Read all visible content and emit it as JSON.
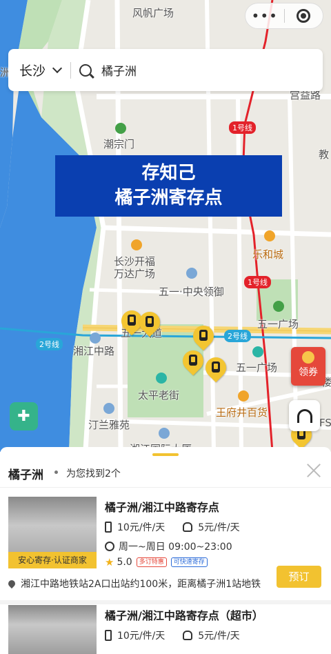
{
  "top": {
    "more_label": "•••"
  },
  "search": {
    "city": "长沙",
    "query": "橘子洲"
  },
  "banner": {
    "line1": "存知己",
    "line2": "橘子洲寄存点"
  },
  "map": {
    "labels": [
      {
        "text": "风帆广场",
        "style": "plain"
      },
      {
        "text": "宫益路",
        "style": "plain"
      },
      {
        "text": "潮宗门",
        "style": "plain"
      },
      {
        "text": "教",
        "style": "plain"
      },
      {
        "text": "乐和城",
        "style": "orange"
      },
      {
        "text": "长沙开福",
        "style": "plain"
      },
      {
        "text": "万达广场",
        "style": "plain"
      },
      {
        "text": "五一·中央领御",
        "style": "plain"
      },
      {
        "text": "五一广场",
        "style": "plain"
      },
      {
        "text": "五一大道",
        "style": "plain"
      },
      {
        "text": "湘江中路",
        "style": "plain"
      },
      {
        "text": "五一广场",
        "style": "plain"
      },
      {
        "text": "太平老街",
        "style": "plain"
      },
      {
        "text": "王府井百货",
        "style": "orange"
      },
      {
        "text": "汀兰雅苑",
        "style": "plain"
      },
      {
        "text": "湘江国际大厦",
        "style": "plain"
      },
      {
        "text": "洲",
        "style": "plain"
      },
      {
        "text": "FS",
        "style": "plain"
      },
      {
        "text": "楼",
        "style": "plain"
      }
    ],
    "line_badges": [
      "1号线",
      "1号线",
      "2号线",
      "2号线"
    ],
    "coupon_label": "领券"
  },
  "sheet": {
    "title": "橘子洲",
    "count_text": "为您找到2个"
  },
  "results": [
    {
      "name": "橘子洲/湘江中路寄存点",
      "tag": "安心寄存·认证商家",
      "price_luggage": "10元/件/天",
      "price_bag": "5元/件/天",
      "hours": "周一~周日 09:00~23:00",
      "rating": "5.0",
      "badges": [
        "多订特惠",
        "可快速寄存"
      ],
      "address": "湘江中路地铁站2A口出站约100米，距离橘子洲1站地铁",
      "book_label": "预订"
    },
    {
      "name": "橘子洲/湘江中路寄存点（超市）",
      "price_luggage": "10元/件/天",
      "price_bag": "5元/件/天"
    }
  ],
  "colors": {
    "accent": "#f2c230",
    "banner": "#0a3fb0",
    "river": "#3f8de0",
    "metro_line1": "#e3222a",
    "metro_line2": "#29a6d8"
  }
}
